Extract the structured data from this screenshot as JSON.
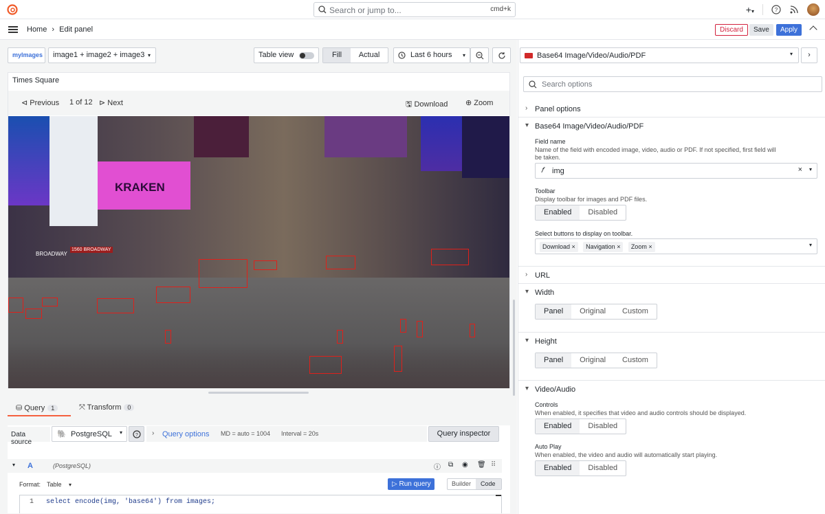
{
  "topbar": {
    "search_placeholder": "Search or jump to...",
    "shortcut": "cmd+k",
    "plus": "+"
  },
  "nav": {
    "home": "Home",
    "sep": "›",
    "current": "Edit panel",
    "discard": "Discard",
    "save": "Save",
    "apply": "Apply"
  },
  "controls": {
    "datasource_tag": "myImages",
    "series_select": "image1 + image2 + image3",
    "table_view": "Table view",
    "fill": "Fill",
    "actual": "Actual",
    "time_range": "Last 6 hours"
  },
  "panel": {
    "title": "Times Square",
    "previous": "Previous",
    "pager": "1 of 12",
    "next": "Next",
    "download": "Download",
    "zoom": "Zoom"
  },
  "image_text": {
    "kraken": "KRAKEN",
    "broadway": "BROADWAY",
    "address": "1560 BROADWAY"
  },
  "tabs": {
    "query": "Query",
    "query_count": "1",
    "transform": "Transform",
    "transform_count": "0"
  },
  "query": {
    "datasource_label": "Data source",
    "datasource": "PostgreSQL",
    "options_link": "Query options",
    "md": "MD = auto = 1004",
    "interval": "Interval = 20s",
    "inspector": "Query inspector",
    "ref_id": "A",
    "ref_ds": "(PostgreSQL)",
    "format_label": "Format:",
    "format_value": "Table",
    "run": "Run query",
    "builder": "Builder",
    "code": "Code",
    "line_no": "1",
    "sql": "select encode(img, 'base64') from images;"
  },
  "options": {
    "viz_name": "Base64 Image/Video/Audio/PDF",
    "search_placeholder": "Search options",
    "panel_options": "Panel options",
    "plugin_section": "Base64 Image/Video/Audio/PDF",
    "field_name_label": "Field name",
    "field_name_desc": "Name of the field with encoded image, video, audio or PDF. If not specified, first field will be taken.",
    "field_value": "img",
    "toolbar_label": "Toolbar",
    "toolbar_desc": "Display toolbar for images and PDF files.",
    "enabled": "Enabled",
    "disabled": "Disabled",
    "buttons_label": "Select buttons to display on toolbar.",
    "chips": [
      "Download",
      "Navigation",
      "Zoom"
    ],
    "url": "URL",
    "width": "Width",
    "height": "Height",
    "panel": "Panel",
    "original": "Original",
    "custom": "Custom",
    "video_audio": "Video/Audio",
    "controls_label": "Controls",
    "controls_desc": "When enabled, it specifies that video and audio controls should be displayed.",
    "autoplay_label": "Auto Play",
    "autoplay_desc": "When enabled, the video and audio will automatically start playing."
  }
}
